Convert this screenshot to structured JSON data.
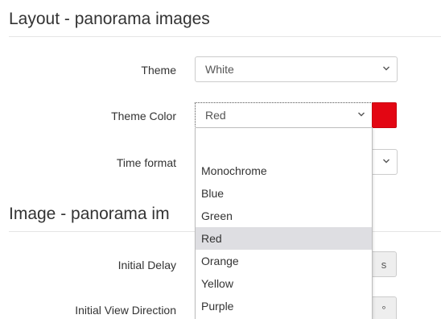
{
  "layout_section": {
    "title": "Layout - panorama images",
    "theme": {
      "label": "Theme",
      "value": "White"
    },
    "theme_color": {
      "label": "Theme Color",
      "value": "Red",
      "swatch_color": "#e30613"
    },
    "time_format": {
      "label": "Time format"
    }
  },
  "image_section": {
    "title": "Image - panorama im",
    "initial_delay": {
      "label": "Initial Delay",
      "unit": "s"
    },
    "initial_view_direction": {
      "label": "Initial View Direction",
      "unit": "°"
    }
  },
  "theme_color_dropdown": {
    "options": [
      "",
      "Monochrome",
      "Blue",
      "Green",
      "Red",
      "Orange",
      "Yellow",
      "Purple"
    ],
    "selected": "Red"
  }
}
